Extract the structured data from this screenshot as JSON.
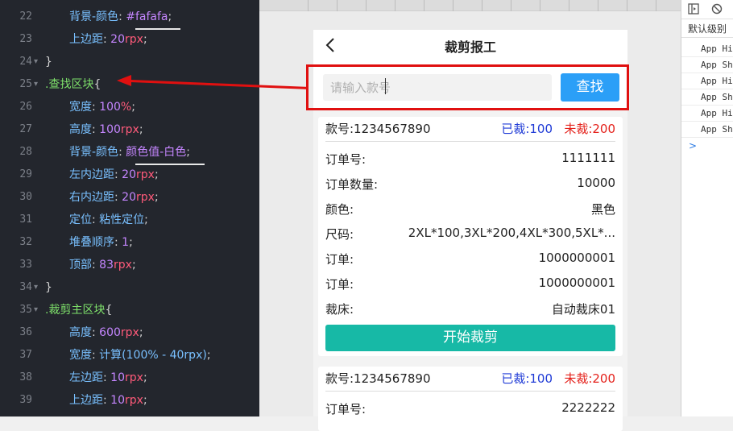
{
  "editor": {
    "lines": [
      {
        "n": "22",
        "prop": "背景-颜色",
        "val": "#fafafa",
        "kind": "hex"
      },
      {
        "n": "23",
        "prop": "上边距",
        "num": "20",
        "unit": "rpx"
      },
      {
        "n": "24",
        "text": "}"
      },
      {
        "n": "25",
        "selector": ".查找区块",
        "brace": "{"
      },
      {
        "n": "26",
        "prop": "宽度",
        "num": "100",
        "unit": "%"
      },
      {
        "n": "27",
        "prop": "高度",
        "num": "100",
        "unit": "rpx"
      },
      {
        "n": "28",
        "prop": "背景-颜色",
        "val": "颜色值-白色",
        "kind": "word"
      },
      {
        "n": "29",
        "prop": "左内边距",
        "num": "20",
        "unit": "rpx"
      },
      {
        "n": "30",
        "prop": "右内边距",
        "num": "20",
        "unit": "rpx"
      },
      {
        "n": "31",
        "prop": "定位",
        "val": "粘性定位",
        "kind": "plain"
      },
      {
        "n": "32",
        "prop": "堆叠顺序",
        "num": "1",
        "unit": ""
      },
      {
        "n": "33",
        "prop": "顶部",
        "num": "83",
        "unit": "rpx"
      },
      {
        "n": "34",
        "text": "}"
      },
      {
        "n": "35",
        "selector": ".裁剪主区块",
        "brace": "{"
      },
      {
        "n": "36",
        "prop": "高度",
        "num": "600",
        "unit": "rpx"
      },
      {
        "n": "37",
        "prop": "宽度",
        "val": "计算(100% - 40rpx)",
        "kind": "calc"
      },
      {
        "n": "38",
        "prop": "左边距",
        "num": "10",
        "unit": "rpx"
      },
      {
        "n": "39",
        "prop": "上边距",
        "num": "10",
        "unit": "rpx"
      }
    ]
  },
  "page": {
    "title": "裁剪报工",
    "search_placeholder": "请输入款号",
    "search_button": "查找",
    "cards": [
      {
        "style_no": "款号:1234567890",
        "cut_done": "已裁:100",
        "cut_todo": "未裁:200",
        "rows": [
          {
            "k": "订单号:",
            "v": "1111111"
          },
          {
            "k": "订单数量:",
            "v": "10000"
          },
          {
            "k": "颜色:",
            "v": "黑色"
          },
          {
            "k": "尺码:",
            "v": "2XL*100,3XL*200,4XL*300,5XL*..."
          },
          {
            "k": "订单:",
            "v": "1000000001"
          },
          {
            "k": "订单:",
            "v": "1000000001"
          },
          {
            "k": "裁床:",
            "v": "自动裁床01"
          }
        ],
        "start_button": "开始裁剪"
      },
      {
        "style_no": "款号:1234567890",
        "cut_done": "已裁:100",
        "cut_todo": "未裁:200",
        "rows": [
          {
            "k": "订单号:",
            "v": "2222222"
          }
        ]
      }
    ]
  },
  "devtools": {
    "level_label": "默认级别",
    "logs": [
      "App Hi",
      "App Sh",
      "App Hi",
      "App Sh",
      "App Hi",
      "App Sh"
    ],
    "prompt": ">"
  },
  "colors": {
    "red_annotation": "#e01010",
    "search_button": "#2b9ff7",
    "start_button": "#17b9a6",
    "cut_done": "#1f3bd6",
    "cut_todo": "#e4201a"
  }
}
